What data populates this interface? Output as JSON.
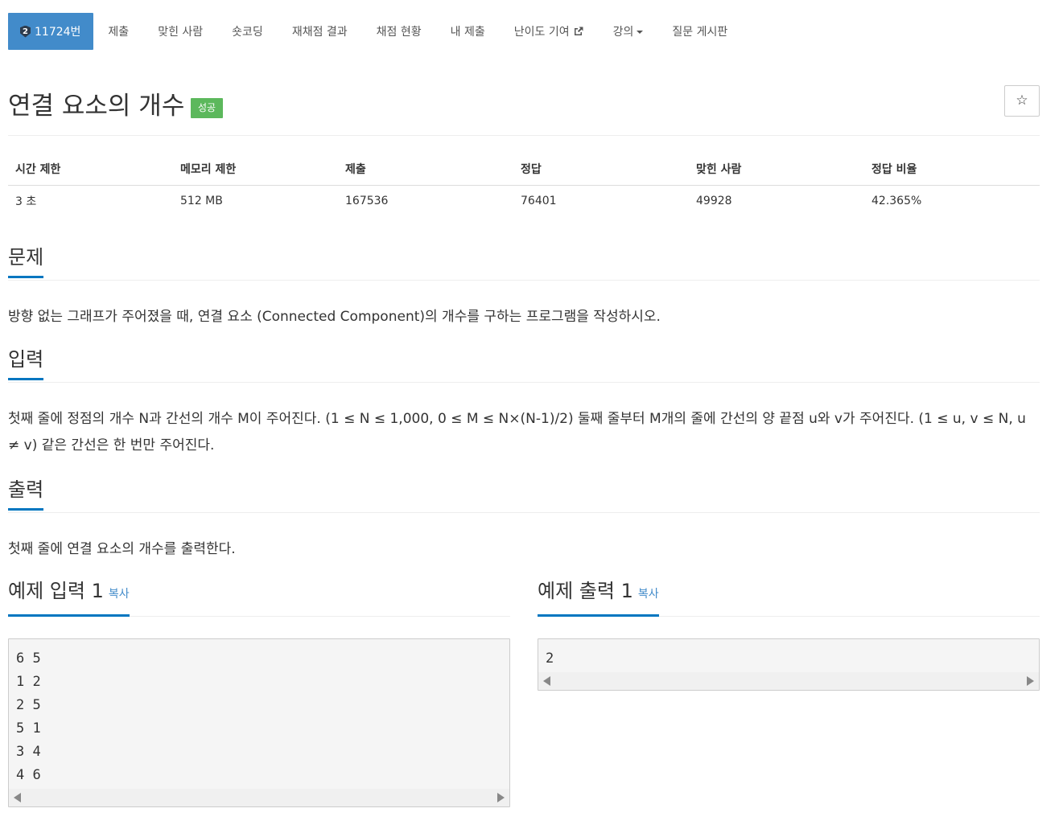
{
  "nav": {
    "problem_number": "11724번",
    "tier_badge": "2",
    "items": [
      {
        "label": "제출"
      },
      {
        "label": "맞힌 사람"
      },
      {
        "label": "숏코딩"
      },
      {
        "label": "재채점 결과"
      },
      {
        "label": "채점 현황"
      },
      {
        "label": "내 제출"
      },
      {
        "label": "난이도 기여"
      },
      {
        "label": "강의"
      },
      {
        "label": "질문 게시판"
      }
    ]
  },
  "problem": {
    "title": "연결 요소의 개수",
    "result_badge": "성공",
    "star_icon": "☆",
    "colors": {
      "nav_active": "#428bca",
      "success": "#5cb85c",
      "section_underline": "#0076c0",
      "link": "#428bca"
    }
  },
  "info": {
    "headers": [
      "시간 제한",
      "메모리 제한",
      "제출",
      "정답",
      "맞힌 사람",
      "정답 비율"
    ],
    "values": [
      "3 초",
      "512 MB",
      "167536",
      "76401",
      "49928",
      "42.365%"
    ]
  },
  "sections": {
    "description": {
      "title": "문제",
      "body": "방향 없는 그래프가 주어졌을 때, 연결 요소 (Connected Component)의 개수를 구하는 프로그램을 작성하시오."
    },
    "input": {
      "title": "입력",
      "body": "첫째 줄에 정점의 개수 N과 간선의 개수 M이 주어진다. (1 ≤ N ≤ 1,000, 0 ≤ M ≤ N×(N-1)/2) 둘째 줄부터 M개의 줄에 간선의 양 끝점 u와 v가 주어진다. (1 ≤ u, v ≤ N, u ≠ v) 같은 간선은 한 번만 주어진다."
    },
    "output": {
      "title": "출력",
      "body": "첫째 줄에 연결 요소의 개수를 출력한다."
    }
  },
  "samples": {
    "input": {
      "title": "예제 입력 1",
      "copy_label": "복사",
      "content": "6 5\n1 2\n2 5\n5 1\n3 4\n4 6"
    },
    "output": {
      "title": "예제 출력 1",
      "copy_label": "복사",
      "content": "2"
    }
  }
}
